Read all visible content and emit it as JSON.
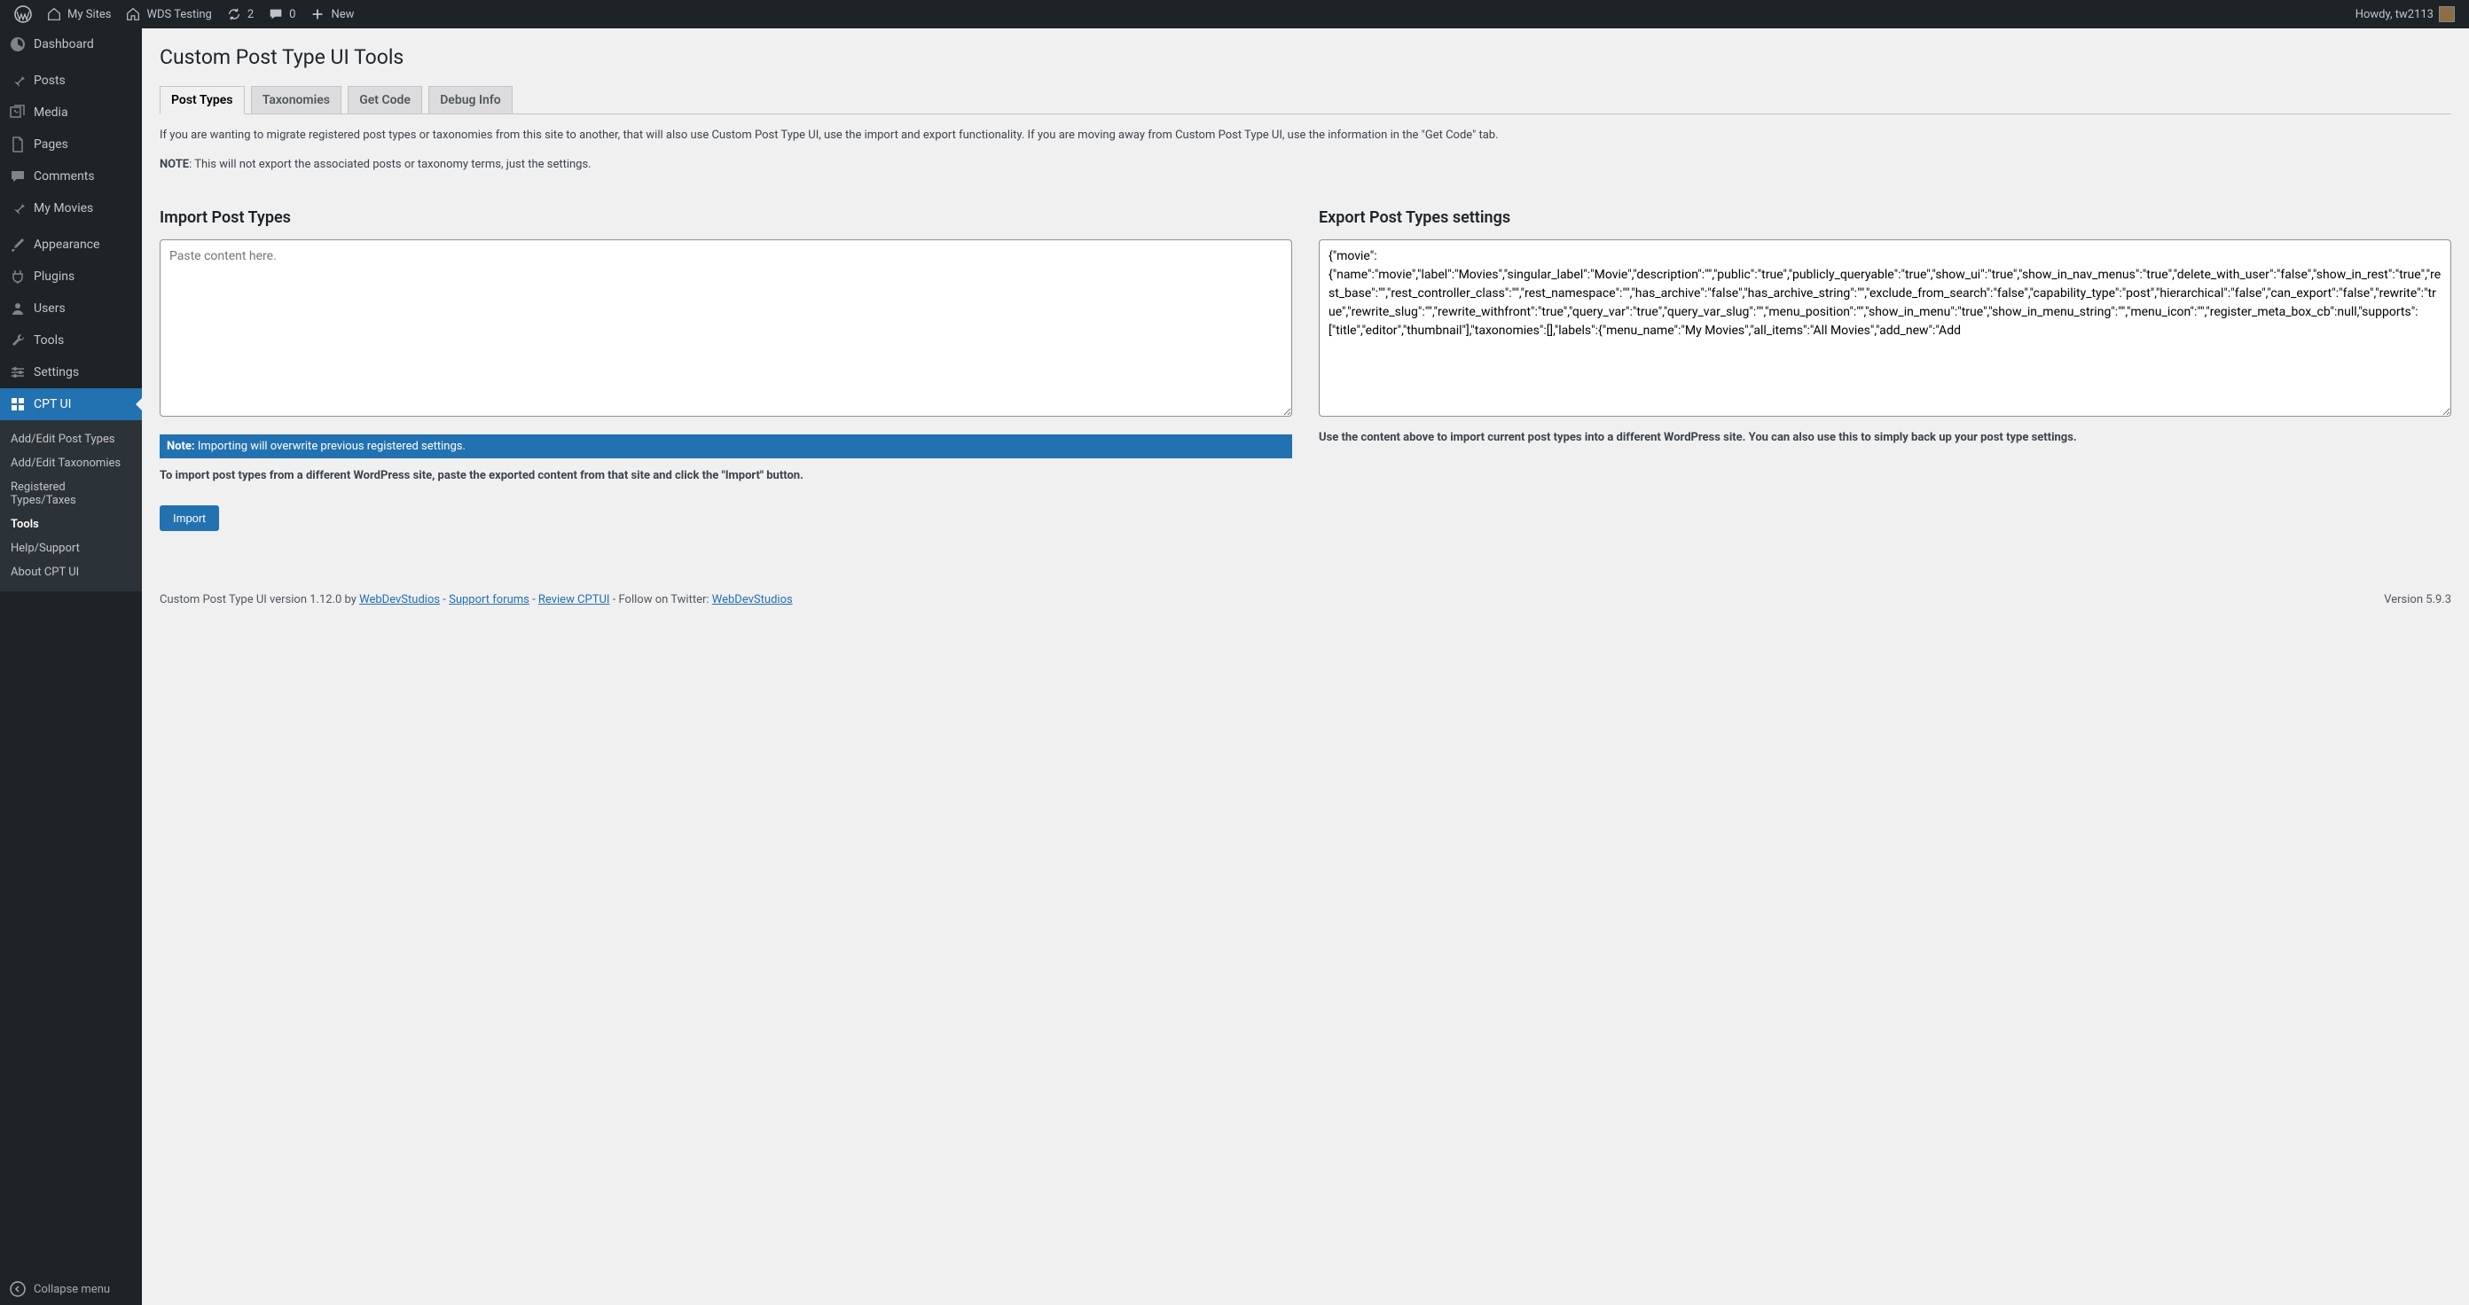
{
  "toolbar": {
    "my_sites": "My Sites",
    "site_name": "WDS Testing",
    "updates": "2",
    "comments": "0",
    "new": "New",
    "howdy": "Howdy, tw2113"
  },
  "sidebar": {
    "dashboard": "Dashboard",
    "posts": "Posts",
    "media": "Media",
    "pages": "Pages",
    "comments": "Comments",
    "my_movies": "My Movies",
    "appearance": "Appearance",
    "plugins": "Plugins",
    "users": "Users",
    "tools": "Tools",
    "settings": "Settings",
    "cpt_ui": "CPT UI",
    "collapse": "Collapse menu"
  },
  "submenu": {
    "add_edit_post_types": "Add/Edit Post Types",
    "add_edit_taxonomies": "Add/Edit Taxonomies",
    "registered": "Registered Types/Taxes",
    "tools": "Tools",
    "help": "Help/Support",
    "about": "About CPT UI"
  },
  "page": {
    "title": "Custom Post Type UI Tools",
    "tabs": {
      "post_types": "Post Types",
      "taxonomies": "Taxonomies",
      "get_code": "Get Code",
      "debug_info": "Debug Info"
    },
    "intro": "If you are wanting to migrate registered post types or taxonomies from this site to another, that will also use Custom Post Type UI, use the import and export functionality. If you are moving away from Custom Post Type UI, use the information in the \"Get Code\" tab.",
    "note_label": "NOTE",
    "note": ": This will not export the associated posts or taxonomy terms, just the settings."
  },
  "import": {
    "heading": "Import Post Types",
    "placeholder": "Paste content here.",
    "notice_bold": "Note:",
    "notice": " Importing will overwrite previous registered settings.",
    "help": "To import post types from a different WordPress site, paste the exported content from that site and click the \"Import\" button.",
    "button": "Import"
  },
  "export": {
    "heading": "Export Post Types settings",
    "content": "{\"movie\":{\"name\":\"movie\",\"label\":\"Movies\",\"singular_label\":\"Movie\",\"description\":\"\",\"public\":\"true\",\"publicly_queryable\":\"true\",\"show_ui\":\"true\",\"show_in_nav_menus\":\"true\",\"delete_with_user\":\"false\",\"show_in_rest\":\"true\",\"rest_base\":\"\",\"rest_controller_class\":\"\",\"rest_namespace\":\"\",\"has_archive\":\"false\",\"has_archive_string\":\"\",\"exclude_from_search\":\"false\",\"capability_type\":\"post\",\"hierarchical\":\"false\",\"can_export\":\"false\",\"rewrite\":\"true\",\"rewrite_slug\":\"\",\"rewrite_withfront\":\"true\",\"query_var\":\"true\",\"query_var_slug\":\"\",\"menu_position\":\"\",\"show_in_menu\":\"true\",\"show_in_menu_string\":\"\",\"menu_icon\":\"\",\"register_meta_box_cb\":null,\"supports\":[\"title\",\"editor\",\"thumbnail\"],\"taxonomies\":[],\"labels\":{\"menu_name\":\"My Movies\",\"all_items\":\"All Movies\",\"add_new\":\"Add",
    "help": "Use the content above to import current post types into a different WordPress site. You can also use this to simply back up your post type settings."
  },
  "footer": {
    "prefix": "Custom Post Type UI version 1.12.0 by ",
    "link1": "WebDevStudios",
    "sep1": " - ",
    "link2": "Support forums",
    "sep2": " - ",
    "link3": "Review CPTUI",
    "suffix": " - Follow on Twitter: ",
    "link4": "WebDevStudios",
    "version": "Version 5.9.3"
  }
}
